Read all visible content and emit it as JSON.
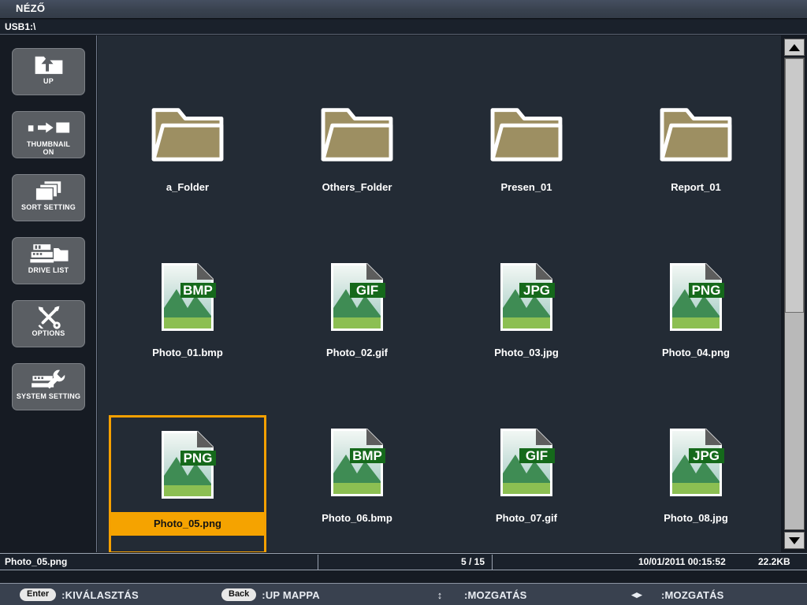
{
  "titlebar": {
    "title": "NÉZŐ"
  },
  "pathbar": {
    "path": "USB1:\\"
  },
  "colors": {
    "accent": "#f5a300",
    "panel_bg": "#232b35",
    "sidebar_bg": "#161b23",
    "titlebar_bg": "#39424f",
    "badge_green": "#15691b",
    "folder_fill": "#9d8f62"
  },
  "sidebar": {
    "items": [
      {
        "label": "UP",
        "icon": "folder-up-icon"
      },
      {
        "label": "THUMBNAIL\nON",
        "label_line1": "THUMBNAIL",
        "label_line2": "ON",
        "icon": "thumbnail-toggle-icon"
      },
      {
        "label": "SORT SETTING",
        "icon": "stacked-pages-icon"
      },
      {
        "label": "DRIVE LIST",
        "icon": "drive-list-icon"
      },
      {
        "label": "OPTIONS",
        "icon": "tools-icon"
      },
      {
        "label": "SYSTEM SETTING",
        "icon": "system-wrench-icon"
      }
    ]
  },
  "files": {
    "items": [
      {
        "name": "a_Folder",
        "type": "folder",
        "badge": ""
      },
      {
        "name": "Others_Folder",
        "type": "folder",
        "badge": ""
      },
      {
        "name": "Presen_01",
        "type": "folder",
        "badge": ""
      },
      {
        "name": "Report_01",
        "type": "folder",
        "badge": ""
      },
      {
        "name": "Photo_01.bmp",
        "type": "image",
        "badge": "BMP"
      },
      {
        "name": "Photo_02.gif",
        "type": "image",
        "badge": "GIF"
      },
      {
        "name": "Photo_03.jpg",
        "type": "image",
        "badge": "JPG"
      },
      {
        "name": "Photo_04.png",
        "type": "image",
        "badge": "PNG"
      },
      {
        "name": "Photo_05.png",
        "type": "image",
        "badge": "PNG",
        "selected": true
      },
      {
        "name": "Photo_06.bmp",
        "type": "image",
        "badge": "BMP"
      },
      {
        "name": "Photo_07.gif",
        "type": "image",
        "badge": "GIF"
      },
      {
        "name": "Photo_08.jpg",
        "type": "image",
        "badge": "JPG"
      }
    ]
  },
  "statusbar": {
    "selected_file": "Photo_05.png",
    "counter": "5 / 15",
    "datetime": "10/01/2011  00:15:52",
    "filesize": "22.2KB"
  },
  "helpbar": {
    "items": [
      {
        "key": "Enter",
        "key_type": "pill",
        "action": ":KIVÁLASZTÁS"
      },
      {
        "key": "Back",
        "key_type": "pill",
        "action": ":UP MAPPA"
      },
      {
        "key": "↕",
        "key_type": "glyph",
        "action": ":MOZGATÁS",
        "icon": "up-down-arrow-icon"
      },
      {
        "key": "◂▸",
        "key_type": "glyph",
        "action": ":MOZGATÁS",
        "icon": "left-right-arrow-icon"
      }
    ]
  },
  "scrollbar": {
    "up_icon": "triangle-up-icon",
    "down_icon": "triangle-down-icon"
  }
}
